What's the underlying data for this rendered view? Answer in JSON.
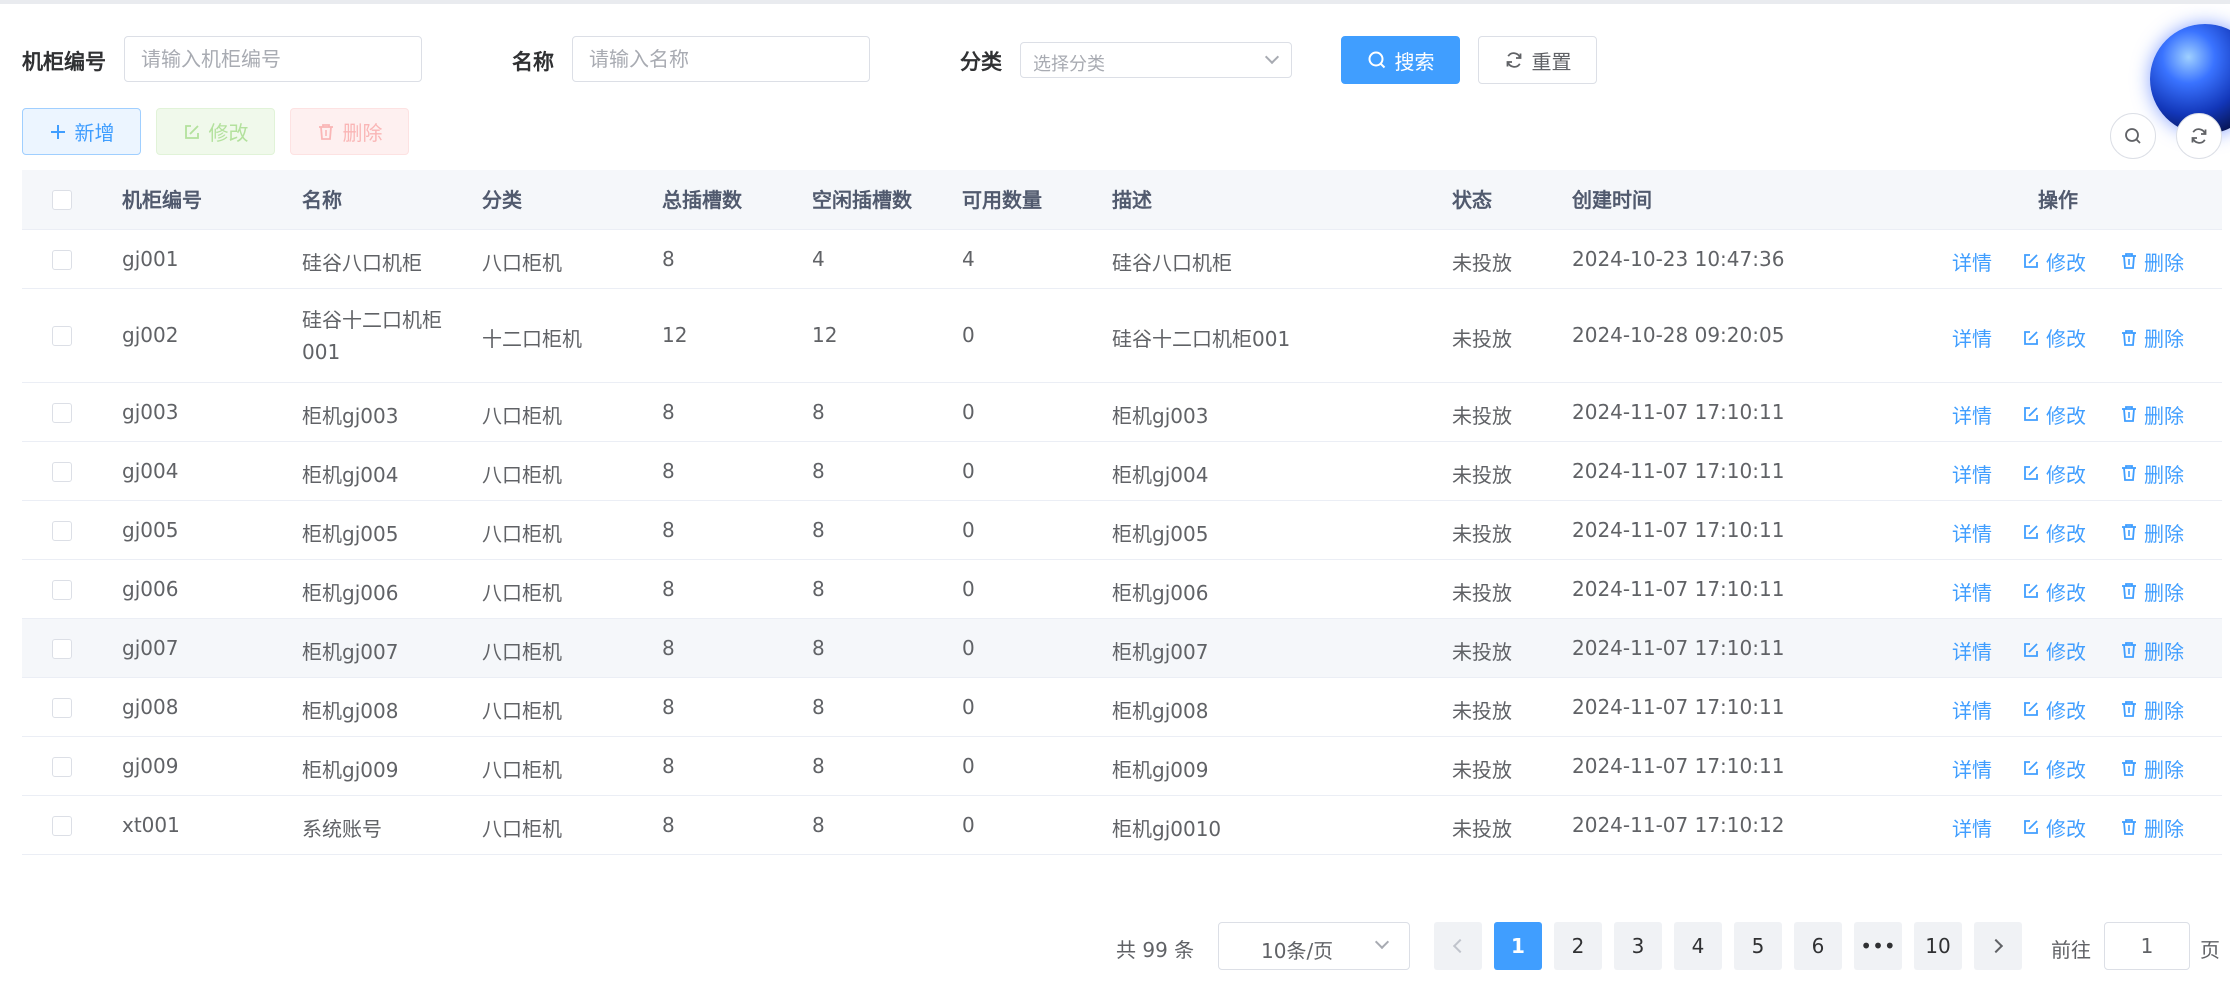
{
  "search": {
    "cabinet_no_label": "机柜编号",
    "cabinet_no_placeholder": "请输入机柜编号",
    "name_label": "名称",
    "name_placeholder": "请输入名称",
    "category_label": "分类",
    "category_placeholder": "选择分类",
    "search_button": "搜索",
    "reset_button": "重置"
  },
  "toolbar": {
    "add_label": "新增",
    "edit_label": "修改",
    "delete_label": "删除"
  },
  "colors": {
    "primary": "#409eff",
    "success_light": "#b3e19d",
    "danger_light": "#fab6b6"
  },
  "table": {
    "headers": [
      "机柜编号",
      "名称",
      "分类",
      "总插槽数",
      "空闲插槽数",
      "可用数量",
      "描述",
      "状态",
      "创建时间",
      "操作"
    ],
    "actions": {
      "detail": "详情",
      "edit": "修改",
      "delete": "删除"
    },
    "rows": [
      {
        "code": "gj001",
        "name": "硅谷八口机柜",
        "category": "八口柜机",
        "total": "8",
        "free": "4",
        "available": "4",
        "desc": "硅谷八口机柜",
        "status": "未投放",
        "created": "2024-10-23 10:47:36"
      },
      {
        "code": "gj002",
        "name": "硅谷十二口机柜001",
        "category": "十二口柜机",
        "total": "12",
        "free": "12",
        "available": "0",
        "desc": "硅谷十二口机柜001",
        "status": "未投放",
        "created": "2024-10-28 09:20:05"
      },
      {
        "code": "gj003",
        "name": "柜机gj003",
        "category": "八口柜机",
        "total": "8",
        "free": "8",
        "available": "0",
        "desc": "柜机gj003",
        "status": "未投放",
        "created": "2024-11-07 17:10:11"
      },
      {
        "code": "gj004",
        "name": "柜机gj004",
        "category": "八口柜机",
        "total": "8",
        "free": "8",
        "available": "0",
        "desc": "柜机gj004",
        "status": "未投放",
        "created": "2024-11-07 17:10:11"
      },
      {
        "code": "gj005",
        "name": "柜机gj005",
        "category": "八口柜机",
        "total": "8",
        "free": "8",
        "available": "0",
        "desc": "柜机gj005",
        "status": "未投放",
        "created": "2024-11-07 17:10:11"
      },
      {
        "code": "gj006",
        "name": "柜机gj006",
        "category": "八口柜机",
        "total": "8",
        "free": "8",
        "available": "0",
        "desc": "柜机gj006",
        "status": "未投放",
        "created": "2024-11-07 17:10:11"
      },
      {
        "code": "gj007",
        "name": "柜机gj007",
        "category": "八口柜机",
        "total": "8",
        "free": "8",
        "available": "0",
        "desc": "柜机gj007",
        "status": "未投放",
        "created": "2024-11-07 17:10:11"
      },
      {
        "code": "gj008",
        "name": "柜机gj008",
        "category": "八口柜机",
        "total": "8",
        "free": "8",
        "available": "0",
        "desc": "柜机gj008",
        "status": "未投放",
        "created": "2024-11-07 17:10:11"
      },
      {
        "code": "gj009",
        "name": "柜机gj009",
        "category": "八口柜机",
        "total": "8",
        "free": "8",
        "available": "0",
        "desc": "柜机gj009",
        "status": "未投放",
        "created": "2024-11-07 17:10:11"
      },
      {
        "code": "xt001",
        "name": "系统账号",
        "category": "八口柜机",
        "total": "8",
        "free": "8",
        "available": "0",
        "desc": "柜机gj0010",
        "status": "未投放",
        "created": "2024-11-07 17:10:12"
      }
    ]
  },
  "pagination": {
    "total_text": "共 99 条",
    "page_size": "10条/页",
    "pages": [
      "1",
      "2",
      "3",
      "4",
      "5",
      "6",
      "•••",
      "10"
    ],
    "current_page": "1",
    "goto_prefix": "前往",
    "goto_value": "1",
    "goto_suffix": "页"
  }
}
